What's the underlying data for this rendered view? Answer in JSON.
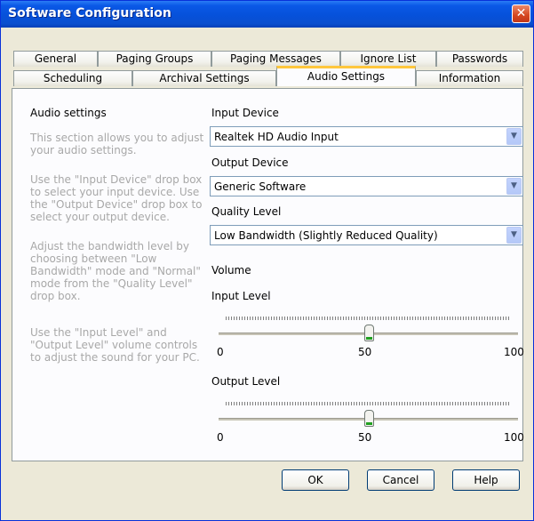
{
  "window": {
    "title": "Software Configuration",
    "close_symbol": "✕"
  },
  "tabs_row1": [
    "General",
    "Paging Groups",
    "Paging Messages",
    "Ignore List",
    "Passwords"
  ],
  "tabs_row2": [
    "Scheduling",
    "Archival Settings",
    "Audio Settings",
    "Information"
  ],
  "active_tab": "Audio Settings",
  "left": {
    "heading": "Audio settings",
    "help": [
      "This section allows you to adjust your audio settings.",
      "Use the \"Input Device\" drop box to select your input device.  Use the \"Output Device\" drop box to select your output device.",
      "Adjust the bandwidth level by choosing between \"Low Bandwidth\" mode and \"Normal\" mode from the \"Quality Level\" drop box.",
      "Use the \"Input Level\" and \"Output Level\" volume controls to adjust the sound for your PC."
    ]
  },
  "input_device": {
    "label": "Input Device",
    "value": "Realtek HD Audio Input"
  },
  "output_device": {
    "label": "Output Device",
    "value": "Generic Software"
  },
  "quality_level": {
    "label": "Quality Level",
    "value": "Low Bandwidth (Slightly Reduced Quality)"
  },
  "volume": {
    "label": "Volume",
    "input_level": {
      "label": "Input Level",
      "min": "0",
      "mid": "50",
      "max": "100",
      "value": 50
    },
    "output_level": {
      "label": "Output Level",
      "min": "0",
      "mid": "50",
      "max": "100",
      "value": 50
    }
  },
  "buttons": {
    "ok": "OK",
    "cancel": "Cancel",
    "help": "Help"
  },
  "colors": {
    "titlebar": "#0a58e6",
    "tab_highlight": "#ffc73c",
    "dialog_bg": "#ece9d8",
    "help_text": "#a8a8a8"
  },
  "icons": {
    "dropdown": "chevron-down-icon",
    "close": "close-icon"
  }
}
